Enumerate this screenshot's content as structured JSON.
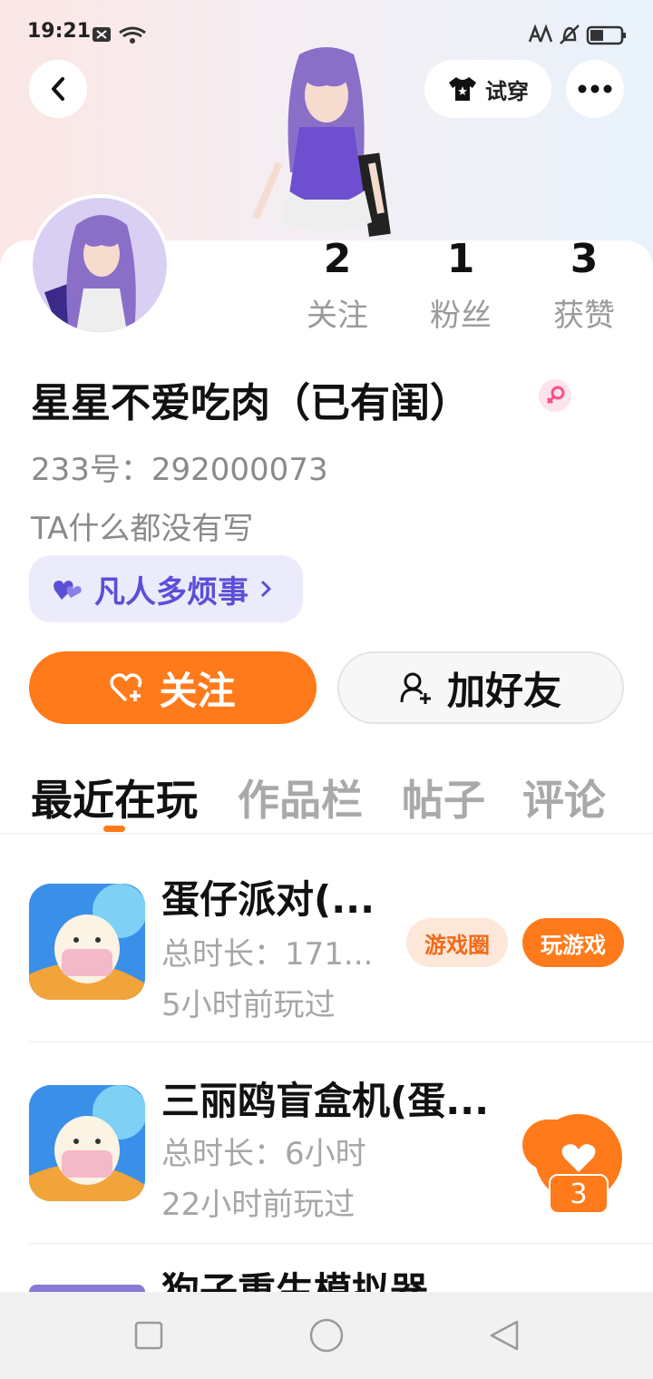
{
  "status_bar": {
    "time": "19:21"
  },
  "header": {
    "try_on_label": "试穿"
  },
  "profile": {
    "name": "星星不爱吃肉（已有闺）",
    "id_text": "233号：292000073",
    "bio": "TA什么都没有写",
    "tag_label": "凡人多烦事",
    "stats": [
      {
        "value": "2",
        "label": "关注"
      },
      {
        "value": "1",
        "label": "粉丝"
      },
      {
        "value": "3",
        "label": "获赞"
      }
    ]
  },
  "actions": {
    "follow_label": "关注",
    "add_friend_label": "加好友"
  },
  "tabs": [
    "最近在玩",
    "作品栏",
    "帖子",
    "评论"
  ],
  "games": [
    {
      "title": "蛋仔派对(...",
      "duration": "总时长：171...",
      "last_played": "5小时前玩过",
      "circle_label": "游戏圈",
      "play_label": "玩游戏"
    },
    {
      "title": "三丽鸥盲盒机(蛋...",
      "duration": "总时长：6小时",
      "last_played": "22小时前玩过"
    },
    {
      "title": "狗子重生模拟器"
    }
  ],
  "floating": {
    "like_count": "3"
  },
  "colors": {
    "accent": "#ff7a1a",
    "tag_bg": "#ecebfb",
    "tag_text": "#5b4fd6"
  }
}
